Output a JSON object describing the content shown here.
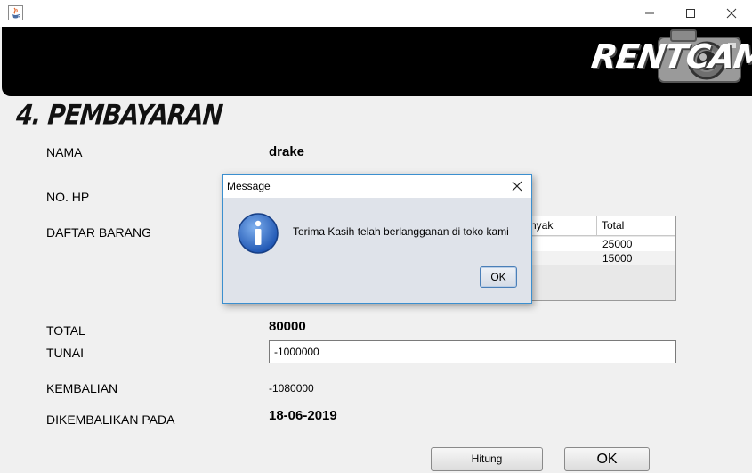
{
  "window": {
    "title": "",
    "icon": "java-cup-icon",
    "controls": {
      "minimize": "minimize-icon",
      "maximize": "maximize-icon",
      "close": "close-icon"
    }
  },
  "header": {
    "logo_text": "RENTCAM",
    "logo_icon": "camera-icon",
    "background": "#000000"
  },
  "page_title": "4. PEMBAYARAN",
  "form": {
    "nama_label": "NAMA",
    "nama_value": "drake",
    "nohp_label": "NO. HP",
    "daftar_label": "DAFTAR BARANG",
    "total_label": "TOTAL",
    "total_value": "80000",
    "tunai_label": "TUNAI",
    "tunai_value": "-1000000",
    "kembalian_label": "KEMBALIAN",
    "kembalian_value": "-1080000",
    "dikembalikan_label": "DIKEMBALIKAN PADA",
    "dikembalikan_value": "18-06-2019"
  },
  "table": {
    "columns": [
      "nyak",
      "Total"
    ],
    "rows": [
      {
        "banyak": "",
        "total": "25000"
      },
      {
        "banyak": "",
        "total": "15000"
      }
    ]
  },
  "buttons": {
    "hitung": "Hitung",
    "ok": "OK"
  },
  "dialog": {
    "title": "Message",
    "message": "Terima Kasih telah berlangganan di toko kami",
    "ok": "OK",
    "icon": "info-icon",
    "accent": "#3b8fcf"
  }
}
